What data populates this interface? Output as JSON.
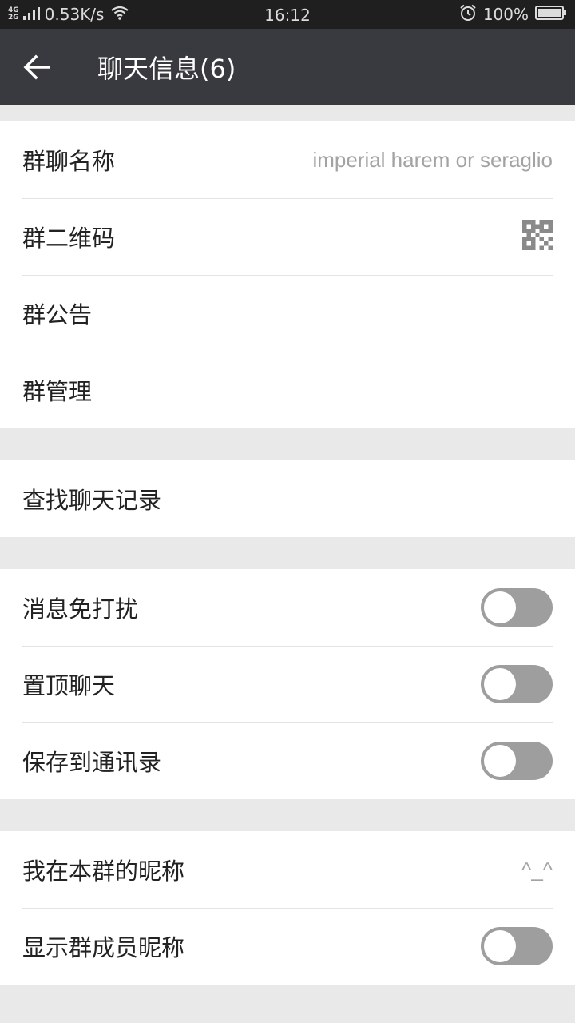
{
  "status_bar": {
    "network_top": "4G",
    "network_bottom": "2G",
    "speed": "0.53K/s",
    "time": "16:12",
    "battery": "100%"
  },
  "header": {
    "title": "聊天信息(6)"
  },
  "group1": {
    "name_label": "群聊名称",
    "name_value": "imperial harem or seraglio",
    "qrcode_label": "群二维码",
    "notice_label": "群公告",
    "manage_label": "群管理"
  },
  "group2": {
    "search_label": "查找聊天记录"
  },
  "group3": {
    "mute_label": "消息免打扰",
    "mute_on": false,
    "pin_label": "置顶聊天",
    "pin_on": false,
    "save_label": "保存到通讯录",
    "save_on": false
  },
  "group4": {
    "nickname_label": "我在本群的昵称",
    "nickname_value": "^_^",
    "show_nick_label": "显示群成员昵称",
    "show_nick_on": false
  },
  "colors": {
    "status_bar_bg": "#1f1f1f",
    "title_bar_bg": "#393a3f",
    "page_bg": "#e9e9e9",
    "toggle_off": "#9e9e9e"
  }
}
